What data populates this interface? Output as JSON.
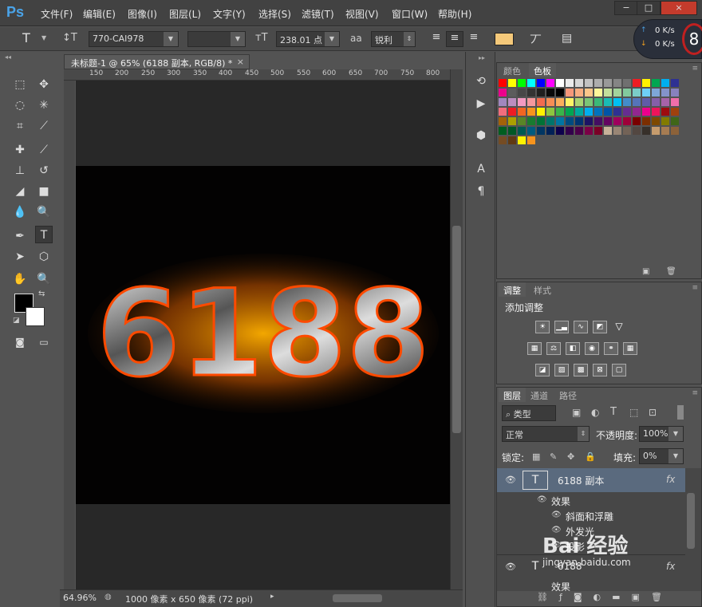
{
  "app": {
    "logo": "Ps"
  },
  "menu": [
    "文件(F)",
    "编辑(E)",
    "图像(I)",
    "图层(L)",
    "文字(Y)",
    "选择(S)",
    "滤镜(T)",
    "视图(V)",
    "窗口(W)",
    "帮助(H)"
  ],
  "window_controls": {
    "minimize": "−",
    "restore": "□",
    "close": "×"
  },
  "network_widget": {
    "up": "0 K/s",
    "down": "0 K/s",
    "badge": "8"
  },
  "options": {
    "tool_glyph": "T",
    "font_family": "770-CAI978",
    "font_style": "",
    "size_label": "238.01 点",
    "aa_label": "aa",
    "antialias": "锐利",
    "text_color": "#f5c97a"
  },
  "document": {
    "tab_title": "未标题-1 @ 65% (6188 副本, RGB/8) *",
    "ruler_ticks": [
      "150",
      "200",
      "250",
      "300",
      "350",
      "400",
      "450",
      "500",
      "550",
      "600",
      "650",
      "700",
      "750",
      "800"
    ],
    "artwork_text": "6188",
    "zoom": "64.96%",
    "doc_info": "1000 像素 x 650 像素 (72 ppi)"
  },
  "swatches_panel": {
    "tabs": [
      "颜色",
      "色板"
    ],
    "active_tab": "色板",
    "colors": [
      "#ff0000",
      "#ffff00",
      "#00ff00",
      "#00ffff",
      "#0000ff",
      "#ff00ff",
      "#ffffff",
      "#ebebeb",
      "#d6d6d6",
      "#c2c2c2",
      "#adadad",
      "#999999",
      "#858585",
      "#707070",
      "#ee1d24",
      "#fff200",
      "#00a651",
      "#00aeef",
      "#2e3192",
      "#ec008c",
      "#5c5c5c",
      "#474747",
      "#333333",
      "#1f1f1f",
      "#0a0a0a",
      "#000000",
      "#f7977a",
      "#f9ad81",
      "#fdc68a",
      "#fff79a",
      "#c4df9b",
      "#a3d39c",
      "#82ca9d",
      "#7bcdc8",
      "#6ecff6",
      "#7ea7d8",
      "#8493ca",
      "#8882be",
      "#a187be",
      "#bc8dbf",
      "#f49ac2",
      "#f6989d",
      "#f26c4f",
      "#f68e55",
      "#fbaf5c",
      "#fff467",
      "#acd372",
      "#7cc576",
      "#3bb878",
      "#1abbb4",
      "#00bff3",
      "#438cca",
      "#5574b9",
      "#605ca8",
      "#855fa8",
      "#a763a8",
      "#f06eaa",
      "#f26d7d",
      "#ed1c24",
      "#f26522",
      "#f7941d",
      "#fff200",
      "#8dc63f",
      "#39b54a",
      "#00a651",
      "#00a99d",
      "#00aeef",
      "#0072bc",
      "#0054a6",
      "#2e3192",
      "#662d91",
      "#92278f",
      "#ec008c",
      "#ed145b",
      "#9e0b0f",
      "#a0410d",
      "#a36209",
      "#aba000",
      "#598527",
      "#197b30",
      "#007236",
      "#00746b",
      "#0076a3",
      "#004b80",
      "#003471",
      "#1b1464",
      "#440e62",
      "#630460",
      "#9e005d",
      "#9e0039",
      "#790000",
      "#7b2e00",
      "#7d4900",
      "#827b00",
      "#406618",
      "#005e20",
      "#005826",
      "#005952",
      "#005b7f",
      "#003663",
      "#002157",
      "#0d004c",
      "#32004b",
      "#4b0049",
      "#7b0046",
      "#7a0026",
      "#c7b299",
      "#998675",
      "#736357",
      "#534741",
      "#37302a",
      "#c69c6d",
      "#a67c52",
      "#8c6239",
      "#754c24",
      "#603913",
      "#fff200",
      "#f7941d"
    ]
  },
  "adjust_panel": {
    "tabs": [
      "调整",
      "样式"
    ],
    "active_tab": "调整",
    "heading": "添加调整"
  },
  "layers_panel": {
    "tabs": [
      "图层",
      "通道",
      "路径"
    ],
    "active_tab": "图层",
    "filter_label": "类型",
    "blend_mode": "正常",
    "opacity_label": "不透明度:",
    "opacity_value": "100%",
    "lock_label": "锁定:",
    "fill_label": "填充:",
    "fill_value": "0%",
    "layers": [
      {
        "name": "6188 副本",
        "selected": true
      },
      {
        "name": "6188",
        "selected": false
      }
    ],
    "effects_label": "效果",
    "effects": [
      "斜面和浮雕",
      "外发光",
      "投影"
    ],
    "second_effects_label": "效果",
    "fx": "fx"
  },
  "watermark": {
    "line1": "Bai 经验",
    "line2": "jingyan.baidu.com"
  }
}
